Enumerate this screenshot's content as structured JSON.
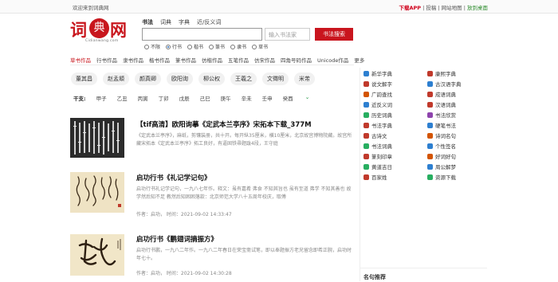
{
  "topbar": {
    "welcome": "欢迎来到词典网",
    "download": "下载APP",
    "links": "| 投稿 | 网站地图 |",
    "desktop": "放到桌面"
  },
  "logo": {
    "char1": "词",
    "char2": "典",
    "char3": "网",
    "sub": "Cidianwang.com"
  },
  "search": {
    "tabs": [
      "书法",
      "词典",
      "字典",
      "近/反义词"
    ],
    "placeholder": "输入书法家",
    "button": "书法搜索",
    "radios": [
      "不限",
      "行书",
      "楷书",
      "篆书",
      "隶书",
      "草书"
    ]
  },
  "catnav": [
    "草书作品",
    "行书作品",
    "隶书作品",
    "楷书作品",
    "篆书作品",
    "仿楷作品",
    "五笔作品",
    "仿宋作品",
    "四角号码作品",
    "Unicode作品",
    "更多"
  ],
  "calligraphers": [
    "董其昌",
    "赵孟頫",
    "颜真卿",
    "欧阳询",
    "柳公权",
    "王羲之",
    "文徵明",
    "米芾"
  ],
  "ganzhi": {
    "label": "干支:",
    "items": [
      "甲子",
      "乙丑",
      "丙寅",
      "丁卯",
      "戊辰",
      "己巳",
      "庚午",
      "辛未",
      "壬申",
      "癸酉"
    ]
  },
  "articles": [
    {
      "title": "【tif高清】欧阳询摹《定武本兰亭序》宋拓本下载_377M",
      "desc": "《定武本兰亭序》，麻纸，剪镶装册，共十开。每开纵35厘米，横10厘米，北京故宫博物院藏。故宫所藏宋拓本《定武本兰亭序》拓工良好，有逼固铁帚题跋4段，王守庭",
      "meta": ""
    },
    {
      "title": "启功行书《礼记学记句》",
      "desc": "启功行书礼记学记句，一九八七年作。释文：虽有嘉肴 弗食 不知其旨也 虽有至道 弗学 不知其善也 故学然后知不足 教然后知困困落款：北京师范大学八十五周年校庆，取傅",
      "meta": "作者：启功，  时间：2021-09-02 14:33:47"
    },
    {
      "title": "启功行书《鹏翅词摘振方》",
      "desc": "启功行书鹏，一九八二年作。一九八二年春日在荣宝斋试笔，即以奉题振方老兄留念即希正腕，启功时年七十。",
      "meta": "作者：启功，  时间：2021-09-02 14:30:28"
    }
  ],
  "sidebar": {
    "items": [
      {
        "label": "新华字典",
        "color": "#2d7fd0"
      },
      {
        "label": "康熙字典",
        "color": "#c0392b"
      },
      {
        "label": "说文解字",
        "color": "#c0392b"
      },
      {
        "label": "古汉语字典",
        "color": "#2d7fd0"
      },
      {
        "label": "广韵查找",
        "color": "#d35400"
      },
      {
        "label": "成语词典",
        "color": "#c0392b"
      },
      {
        "label": "近反义词",
        "color": "#2d7fd0"
      },
      {
        "label": "汉语词典",
        "color": "#c0392b"
      },
      {
        "label": "历史词典",
        "color": "#27ae60"
      },
      {
        "label": "书法欣赏",
        "color": "#8e44ad"
      },
      {
        "label": "书法字典",
        "color": "#c0392b"
      },
      {
        "label": "硬笔书法",
        "color": "#2d7fd0"
      },
      {
        "label": "古诗文",
        "color": "#c0392b"
      },
      {
        "label": "诗词名句",
        "color": "#d35400"
      },
      {
        "label": "书法词典",
        "color": "#27ae60"
      },
      {
        "label": "个性签名",
        "color": "#2d7fd0"
      },
      {
        "label": "篆刻印章",
        "color": "#c0392b"
      },
      {
        "label": "好词好句",
        "color": "#d35400"
      },
      {
        "label": "黄道吉日",
        "color": "#27ae60"
      },
      {
        "label": "周公解梦",
        "color": "#2d7fd0"
      },
      {
        "label": "百家姓",
        "color": "#c0392b"
      },
      {
        "label": "资源下载",
        "color": "#27ae60"
      }
    ],
    "recommend": "名句推荐"
  }
}
